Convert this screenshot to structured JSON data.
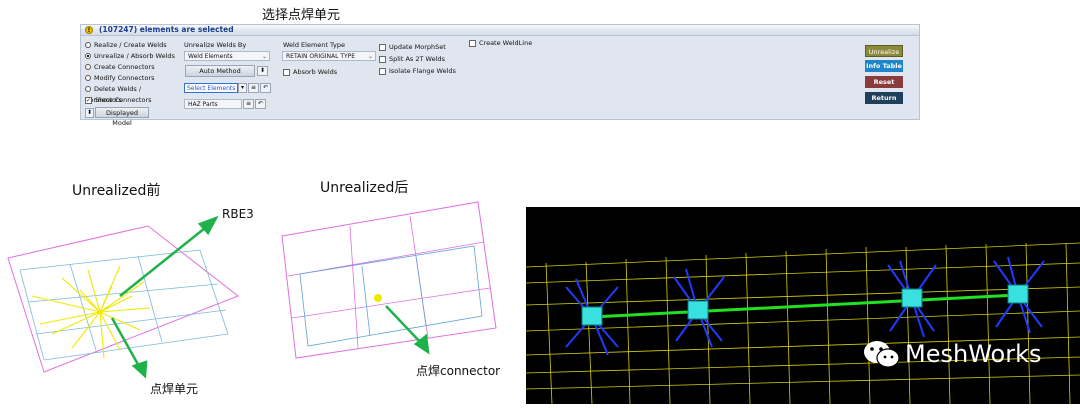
{
  "top_caption": "选择点焊单元",
  "panel": {
    "header": "(107247) elements are selected",
    "radios": [
      {
        "label": "Realize / Create Welds",
        "selected": false
      },
      {
        "label": "Unrealize / Absorb Welds",
        "selected": true
      },
      {
        "label": "Create Connectors",
        "selected": false
      },
      {
        "label": "Modify Connectors",
        "selected": false
      },
      {
        "label": "Delete Welds / Connectors",
        "selected": false
      }
    ],
    "show_connectors": "Show Connectors",
    "displayed_model": "Displayed Model",
    "unrealize_by_label": "Unrealize Welds By",
    "unrealize_by_value": "Weld Elements",
    "auto_method": "Auto Method",
    "select_elements": "Select Elements",
    "haz_parts": "HAZ Parts",
    "weld_type_label": "Weld Element Type",
    "weld_type_value": "RETAIN ORIGINAL TYPE",
    "absorb_welds": "Absorb Welds",
    "update_morphset": "Update MorphSet",
    "split_2t": "Split As 2T Welds",
    "isolate_flange": "Isolate Flange Welds",
    "create_weldline": "Create WeldLine",
    "buttons": {
      "unrealize": "Unrealize",
      "info_table": "Info Table",
      "reset": "Reset",
      "return": "Return"
    },
    "colors": {
      "unrealize": "#8a8a3a",
      "info_table": "#1e86c8",
      "reset": "#8a3b3b",
      "return": "#203f5a"
    }
  },
  "left_figure": {
    "title": "Unrealized前",
    "label_rbe3": "RBE3",
    "label_weld": "点焊单元"
  },
  "mid_figure": {
    "title": "Unrealized后",
    "label_connector": "点焊connector"
  },
  "watermark": {
    "text": "MeshWorks",
    "icon": "wechat-icon"
  }
}
